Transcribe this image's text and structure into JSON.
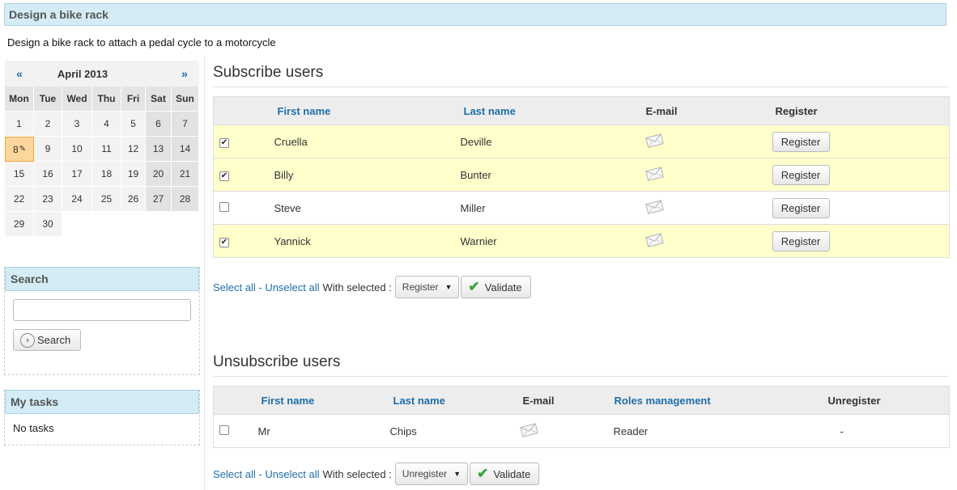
{
  "page": {
    "title": "Design a bike rack",
    "description": "Design a bike rack to attach a pedal cycle to a motorcycle"
  },
  "calendar": {
    "prev": "«",
    "next": "»",
    "month": "April 2013",
    "days_of_week": [
      "Mon",
      "Tue",
      "Wed",
      "Thu",
      "Fri",
      "Sat",
      "Sun"
    ],
    "weeks": [
      [
        "1",
        "2",
        "3",
        "4",
        "5",
        "6",
        "7"
      ],
      [
        "8",
        "9",
        "10",
        "11",
        "12",
        "13",
        "14"
      ],
      [
        "15",
        "16",
        "17",
        "18",
        "19",
        "20",
        "21"
      ],
      [
        "22",
        "23",
        "24",
        "25",
        "26",
        "27",
        "28"
      ],
      [
        "29",
        "30",
        "",
        "",
        "",
        "",
        ""
      ]
    ],
    "today": "8"
  },
  "search": {
    "title": "Search",
    "value": "",
    "button_label": "Search"
  },
  "tasks": {
    "title": "My tasks",
    "empty_text": "No tasks"
  },
  "subscribe": {
    "title": "Subscribe users",
    "headers": {
      "first_name": "First name",
      "last_name": "Last name",
      "email": "E-mail",
      "register": "Register"
    },
    "rows": [
      {
        "checked": true,
        "first": "Cruella",
        "last": "Deville",
        "button": "Register"
      },
      {
        "checked": true,
        "first": "Billy",
        "last": "Bunter",
        "button": "Register"
      },
      {
        "checked": false,
        "first": "Steve",
        "last": "Miller",
        "button": "Register"
      },
      {
        "checked": true,
        "first": "Yannick",
        "last": "Warnier",
        "button": "Register"
      }
    ],
    "select_all": "Select all",
    "separator": " - ",
    "unselect_all": "Unselect all",
    "with_selected": "With selected :",
    "action_value": "Register",
    "validate": "Validate"
  },
  "unsubscribe": {
    "title": "Unsubscribe users",
    "headers": {
      "first_name": "First name",
      "last_name": "Last name",
      "email": "E-mail",
      "roles": "Roles management",
      "unregister": "Unregister"
    },
    "rows": [
      {
        "checked": false,
        "first": "Mr",
        "last": "Chips",
        "role": "Reader",
        "unregister": "-"
      }
    ],
    "select_all": "Select all",
    "separator": " - ",
    "unselect_all": "Unselect all",
    "with_selected": "With selected :",
    "action_value": "Unregister",
    "validate": "Validate"
  },
  "icons": {
    "email": "envelope-icon",
    "check": "check-icon",
    "search": "chevron-right-circle-icon"
  },
  "colors": {
    "header_bg": "#d4ecf5",
    "selected_row": "#ffffcc",
    "link": "#1f6ea9",
    "today": "#fcd69a"
  }
}
